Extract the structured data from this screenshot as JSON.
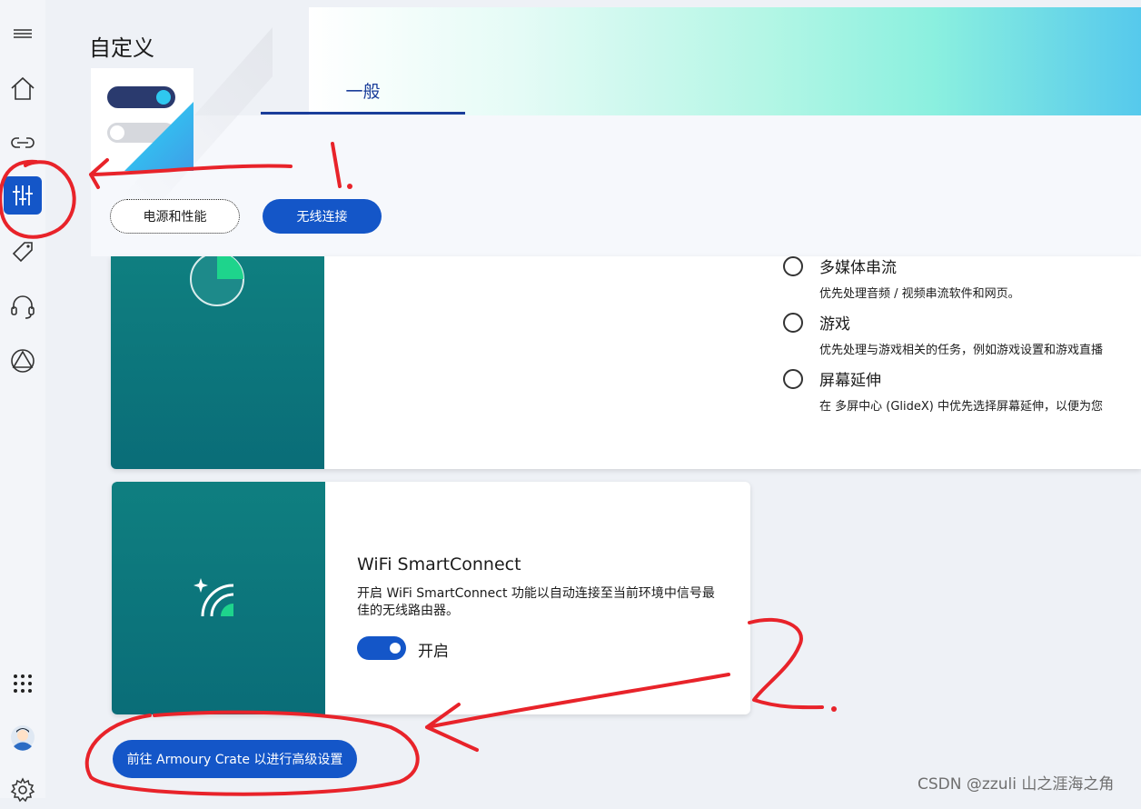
{
  "app": {
    "page_title": "自定义",
    "tabs": [
      {
        "label": "一般",
        "selected": true
      }
    ]
  },
  "sidebar": {
    "items": [
      {
        "icon": "menu-icon"
      },
      {
        "icon": "home-icon"
      },
      {
        "icon": "link-icon"
      },
      {
        "icon": "sliders-icon",
        "active": true
      },
      {
        "icon": "tag-icon"
      },
      {
        "icon": "headset-icon"
      },
      {
        "icon": "triangle-logo-icon"
      },
      {
        "icon": "apps-grid-icon"
      },
      {
        "icon": "avatar"
      },
      {
        "icon": "gear-icon"
      }
    ],
    "accent_color": "#1456c8"
  },
  "filters": {
    "power_label": "电源和性能",
    "wireless_label": "无线连接",
    "selected": "无线连接"
  },
  "priority_options": [
    {
      "title": "多媒体串流",
      "desc": "优先处理音频 / 视频串流软件和网页。",
      "selected": false
    },
    {
      "title": "游戏",
      "desc": "优先处理与游戏相关的任务，例如游戏设置和游戏直播",
      "selected": false
    },
    {
      "title": "屏幕延伸",
      "desc": "在 多屏中心 (GlideX) 中优先选择屏幕延伸，以便为您",
      "selected": false
    }
  ],
  "wifi_card": {
    "title": "WiFi SmartConnect",
    "description": "开启 WiFi SmartConnect 功能以自动连接至当前环境中信号最佳的无线路由器。",
    "toggle_state": "on",
    "toggle_label": "开启",
    "icon": "wifi-sparkle-icon"
  },
  "advanced_button": {
    "label": "前往 Armoury Crate 以进行高级设置"
  },
  "annotations": {
    "step1": "1.",
    "step2": "2.",
    "color": "#e8232a"
  },
  "watermark": "CSDN @zzuli 山之涯海之角"
}
